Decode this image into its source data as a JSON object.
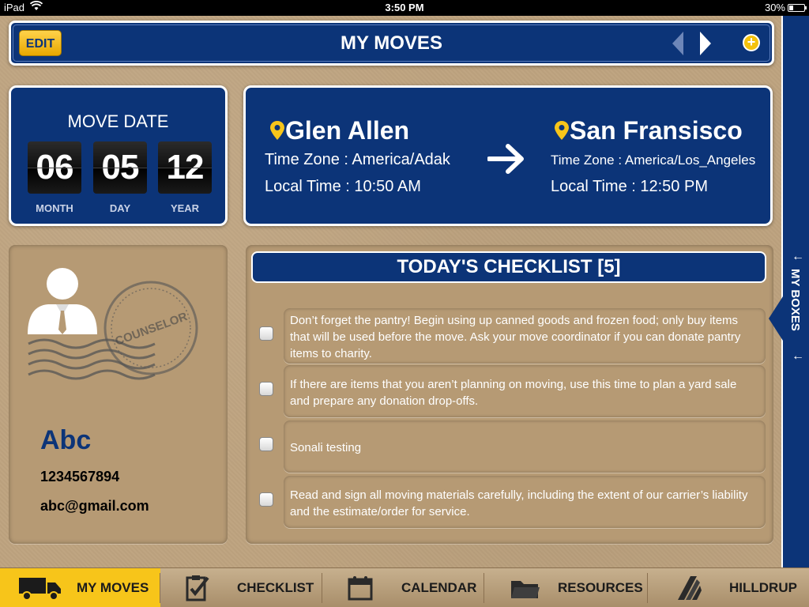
{
  "status_bar": {
    "device": "iPad",
    "time": "3:50 PM",
    "battery": "30%",
    "battery_level": 0.3
  },
  "header": {
    "edit_label": "EDIT",
    "title": "MY MOVES"
  },
  "move_date": {
    "title": "MOVE DATE",
    "month": "06",
    "day": "05",
    "year": "12",
    "month_label": "MONTH",
    "day_label": "DAY",
    "year_label": "YEAR"
  },
  "route": {
    "from": {
      "city": "Glen Allen",
      "timezone": "Time Zone : America/Adak",
      "local_time": "Local Time : 10:50 AM"
    },
    "to": {
      "city": "San Fransisco",
      "timezone": "Time Zone : America/Los_Angeles",
      "local_time": "Local Time : 12:50 PM"
    }
  },
  "counselor": {
    "stamp_text": "COUNSELOR",
    "name": "Abc",
    "phone": "1234567894",
    "email": "abc@gmail.com"
  },
  "checklist": {
    "title": "TODAY'S CHECKLIST [5]",
    "items": [
      {
        "text": "Don’t forget the pantry! Begin using up canned goods and frozen food; only buy items that will be used before the move. Ask your move coordinator if you can donate pantry items to charity.",
        "checked": false
      },
      {
        "text": "If there are items that you aren’t planning on moving, use this time to plan a yard sale and prepare any donation drop-offs.",
        "checked": false
      },
      {
        "text": "Sonali testing",
        "checked": false
      },
      {
        "text": "Read and sign all moving materials carefully, including the extent of our carrier’s liability and the estimate/order for service.",
        "checked": false
      }
    ]
  },
  "side_tab": {
    "label": "MY BOXES"
  },
  "tabbar": {
    "tabs": [
      {
        "label": "MY MOVES",
        "icon": "truck-icon",
        "active": true
      },
      {
        "label": "CHECKLIST",
        "icon": "clipboard-check-icon",
        "active": false
      },
      {
        "label": "CALENDAR",
        "icon": "calendar-icon",
        "active": false
      },
      {
        "label": "RESOURCES",
        "icon": "folder-icon",
        "active": false
      },
      {
        "label": "HILLDRUP",
        "icon": "hilldrup-logo-icon",
        "active": false
      }
    ]
  },
  "colors": {
    "navy": "#0c3478",
    "gold": "#f7c51a",
    "cardboard": "#bea37f"
  }
}
